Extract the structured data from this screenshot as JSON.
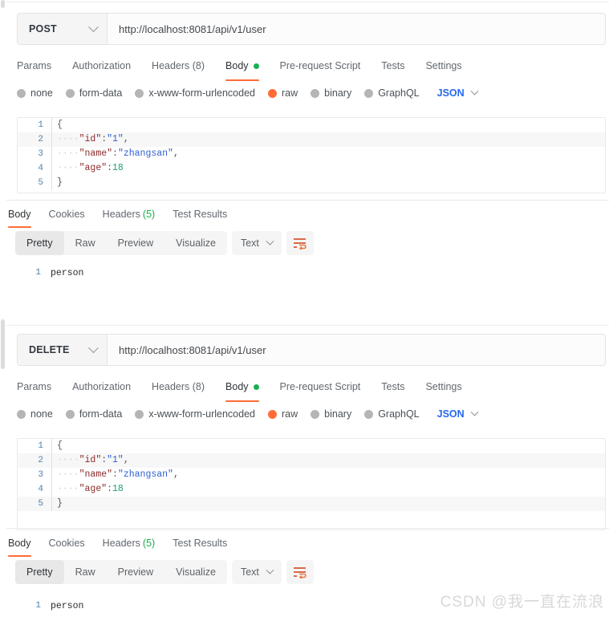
{
  "watermark": "CSDN @我一直在流浪",
  "icons": {
    "chevron_down": "chevron-down-icon",
    "wrap_lines": "wrap-lines-icon"
  },
  "panels": [
    {
      "id": "post-panel",
      "method": "POST",
      "url": "http://localhost:8081/api/v1/user",
      "request_tabs": [
        {
          "label": "Params",
          "active": false,
          "dot": false
        },
        {
          "label": "Authorization",
          "active": false,
          "dot": false
        },
        {
          "label": "Headers (8)",
          "active": false,
          "dot": false
        },
        {
          "label": "Body",
          "active": true,
          "dot": true
        },
        {
          "label": "Pre-request Script",
          "active": false,
          "dot": false
        },
        {
          "label": "Tests",
          "active": false,
          "dot": false
        },
        {
          "label": "Settings",
          "active": false,
          "dot": false
        }
      ],
      "body_types": [
        {
          "label": "none",
          "selected": false
        },
        {
          "label": "form-data",
          "selected": false
        },
        {
          "label": "x-www-form-urlencoded",
          "selected": false
        },
        {
          "label": "raw",
          "selected": true
        },
        {
          "label": "binary",
          "selected": false
        },
        {
          "label": "GraphQL",
          "selected": false
        }
      ],
      "raw_format": "JSON",
      "request_body_lines": [
        {
          "n": "1",
          "indent": "",
          "content": "{",
          "kind": "punc"
        },
        {
          "n": "2",
          "indent": "····",
          "key": "\"id\"",
          "colon": ":",
          "value": "\"1\"",
          "kind": "str",
          "tail": ","
        },
        {
          "n": "3",
          "indent": "····",
          "key": "\"name\"",
          "colon": ":",
          "value": "\"zhangsan\"",
          "kind": "str",
          "tail": ","
        },
        {
          "n": "4",
          "indent": "····",
          "key": "\"age\"",
          "colon": ":",
          "value": "18",
          "kind": "num",
          "tail": ""
        },
        {
          "n": "5",
          "indent": "",
          "content": "}",
          "kind": "punc"
        }
      ],
      "response_tabs": [
        {
          "label": "Body",
          "active": true,
          "count": ""
        },
        {
          "label": "Cookies",
          "active": false,
          "count": ""
        },
        {
          "label": "Headers",
          "active": false,
          "count": "(5)"
        },
        {
          "label": "Test Results",
          "active": false,
          "count": ""
        }
      ],
      "view_modes": [
        {
          "label": "Pretty",
          "active": true
        },
        {
          "label": "Raw",
          "active": false
        },
        {
          "label": "Preview",
          "active": false
        },
        {
          "label": "Visualize",
          "active": false
        }
      ],
      "response_type": "Text",
      "response_lines": [
        {
          "n": "1",
          "text": "person"
        }
      ]
    },
    {
      "id": "delete-panel",
      "method": "DELETE",
      "url": "http://localhost:8081/api/v1/user",
      "request_tabs": [
        {
          "label": "Params",
          "active": false,
          "dot": false
        },
        {
          "label": "Authorization",
          "active": false,
          "dot": false
        },
        {
          "label": "Headers (8)",
          "active": false,
          "dot": false
        },
        {
          "label": "Body",
          "active": true,
          "dot": true
        },
        {
          "label": "Pre-request Script",
          "active": false,
          "dot": false
        },
        {
          "label": "Tests",
          "active": false,
          "dot": false
        },
        {
          "label": "Settings",
          "active": false,
          "dot": false
        }
      ],
      "body_types": [
        {
          "label": "none",
          "selected": false
        },
        {
          "label": "form-data",
          "selected": false
        },
        {
          "label": "x-www-form-urlencoded",
          "selected": false
        },
        {
          "label": "raw",
          "selected": true
        },
        {
          "label": "binary",
          "selected": false
        },
        {
          "label": "GraphQL",
          "selected": false
        }
      ],
      "raw_format": "JSON",
      "request_body_lines": [
        {
          "n": "1",
          "indent": "",
          "content": "{",
          "kind": "punc"
        },
        {
          "n": "2",
          "indent": "····",
          "key": "\"id\"",
          "colon": ":",
          "value": "\"1\"",
          "kind": "str",
          "tail": ","
        },
        {
          "n": "3",
          "indent": "····",
          "key": "\"name\"",
          "colon": ":",
          "value": "\"zhangsan\"",
          "kind": "str",
          "tail": ","
        },
        {
          "n": "4",
          "indent": "····",
          "key": "\"age\"",
          "colon": ":",
          "value": "18",
          "kind": "num",
          "tail": ""
        },
        {
          "n": "5",
          "indent": "",
          "content": "}",
          "kind": "punc"
        }
      ],
      "response_tabs": [
        {
          "label": "Body",
          "active": true,
          "count": ""
        },
        {
          "label": "Cookies",
          "active": false,
          "count": ""
        },
        {
          "label": "Headers",
          "active": false,
          "count": "(5)"
        },
        {
          "label": "Test Results",
          "active": false,
          "count": ""
        }
      ],
      "view_modes": [
        {
          "label": "Pretty",
          "active": true
        },
        {
          "label": "Raw",
          "active": false
        },
        {
          "label": "Preview",
          "active": false
        },
        {
          "label": "Visualize",
          "active": false
        }
      ],
      "response_type": "Text",
      "response_lines": [
        {
          "n": "1",
          "text": "person"
        }
      ]
    }
  ],
  "colors": {
    "accent": "#ff6c37",
    "green": "#1aae4f",
    "blue": "#2568ef"
  }
}
